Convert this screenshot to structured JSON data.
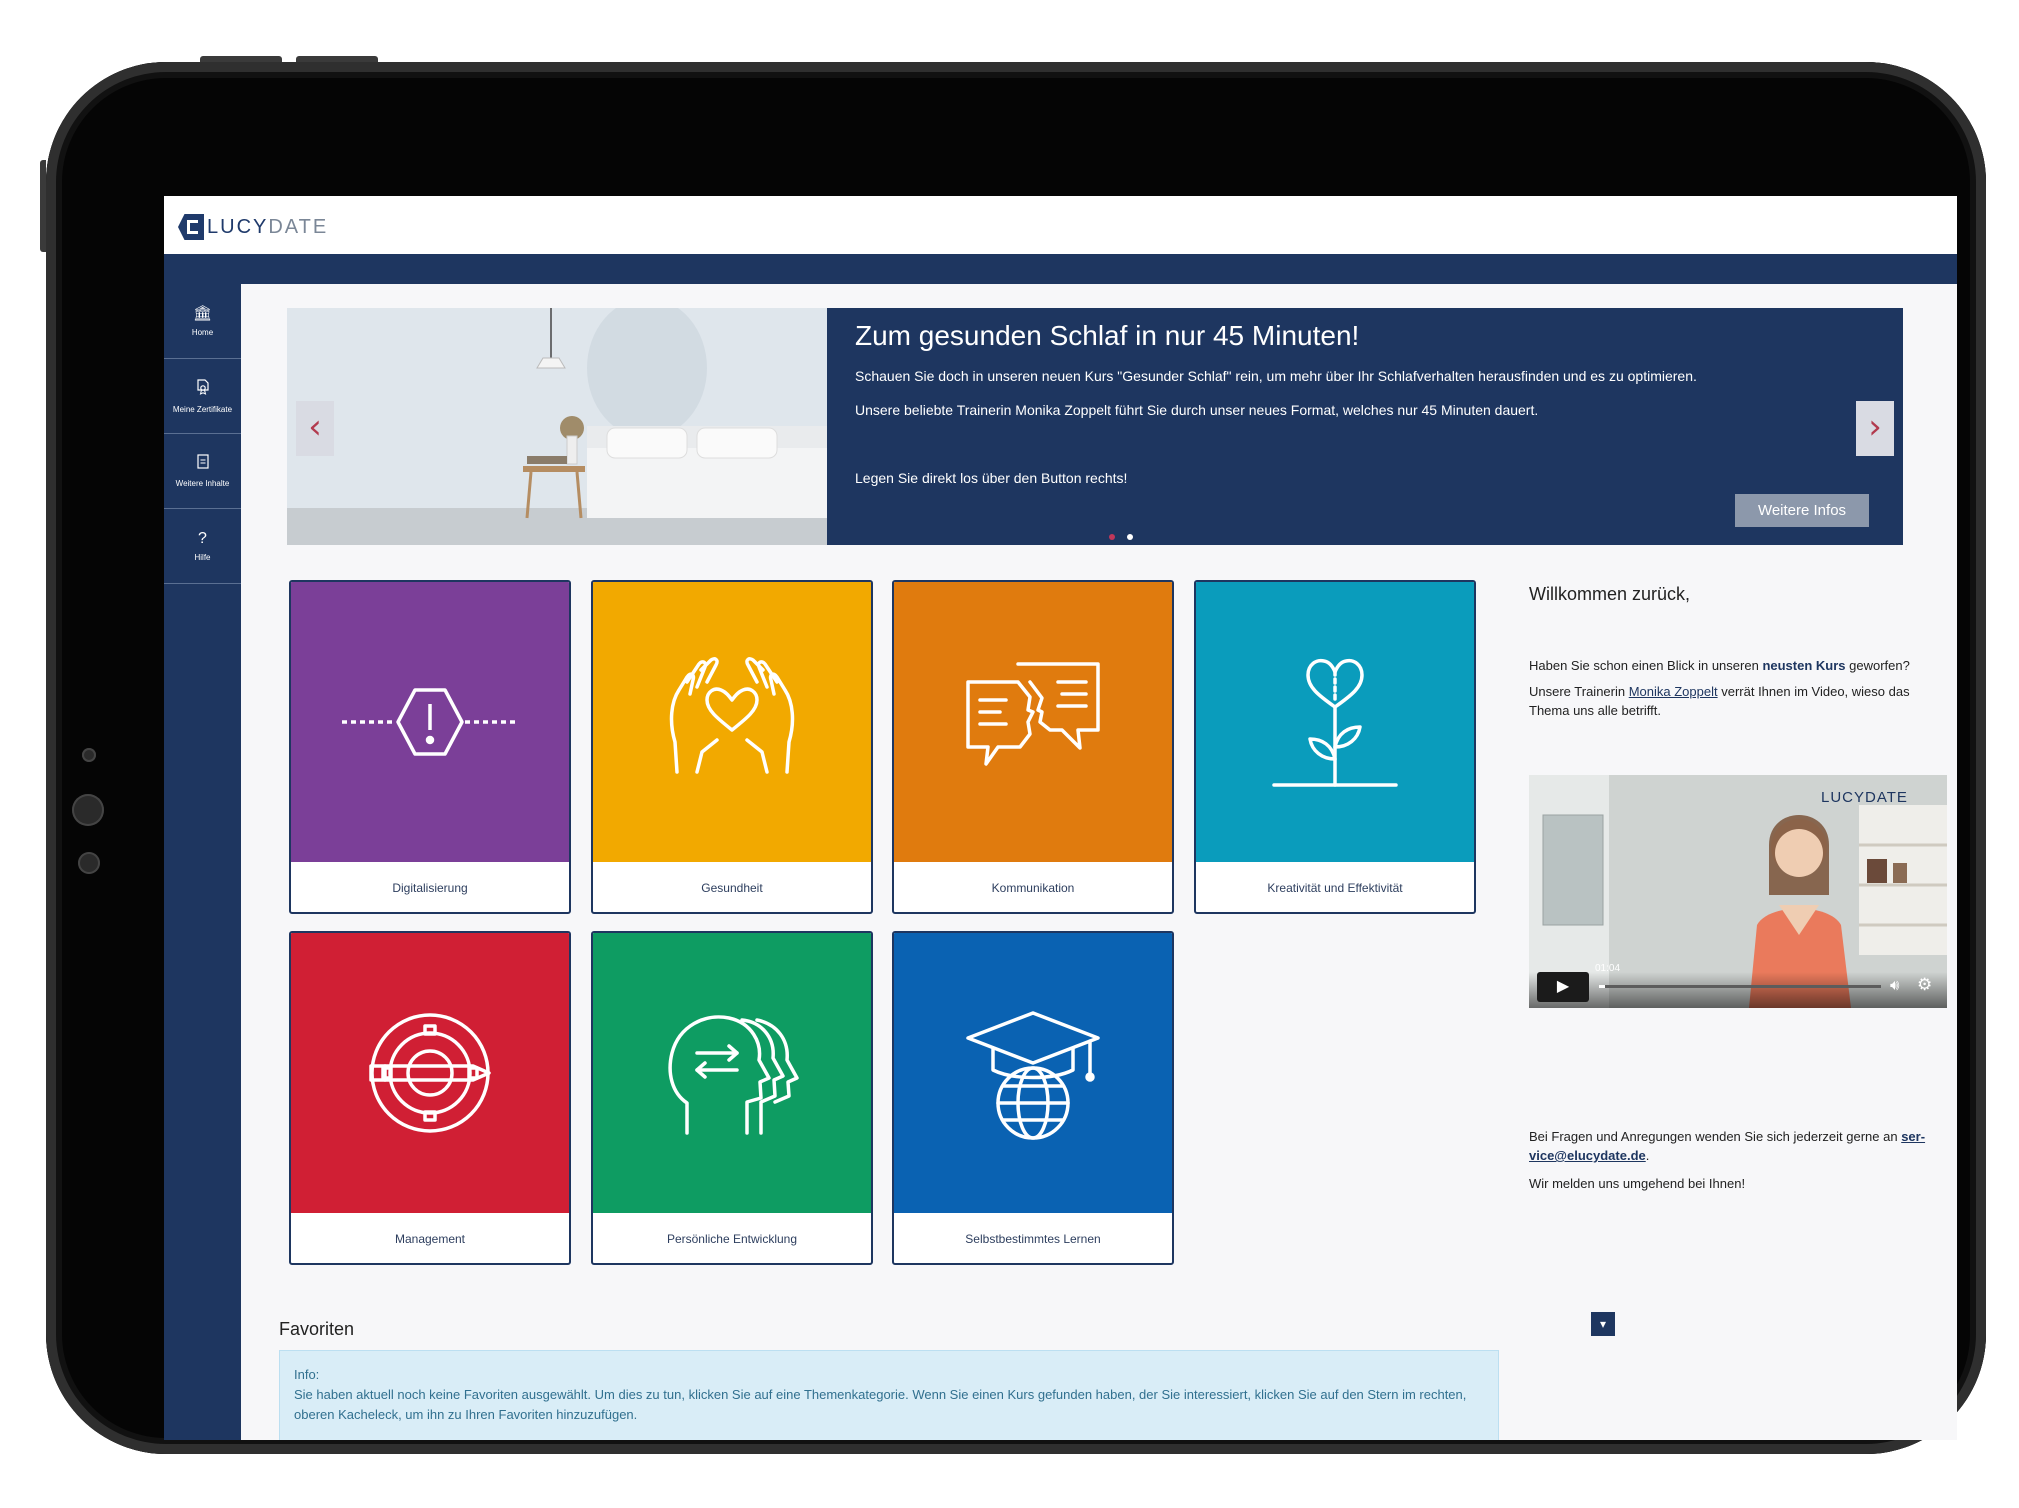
{
  "brand": {
    "logo_main": "LUCY",
    "logo_sub": "DATE"
  },
  "sidebar": {
    "items": [
      {
        "label": "Home",
        "icon": "bank-icon"
      },
      {
        "label": "Meine Zertifikate",
        "icon": "certificate-icon"
      },
      {
        "label": "Weitere Inhalte",
        "icon": "document-icon"
      },
      {
        "label": "Hilfe",
        "icon": "question-icon"
      }
    ]
  },
  "hero": {
    "title": "Zum gesunden Schlaf in nur 45 Minuten!",
    "line1": "Schauen Sie doch in unseren neuen Kurs \"Gesunder Schlaf\" rein, um mehr über Ihr Schlafverhalten herausfinden und es zu optimieren.",
    "line2": "Unsere beliebte Trainerin Monika Zoppelt führt Sie durch unser neues Format, welches nur 45 Minuten dauert.",
    "line3": "Legen Sie direkt los über den Button rechts!",
    "button": "Weitere Infos",
    "prev_arrow": "‹",
    "next_arrow": "›",
    "slide_count": 2,
    "active_slide": 1,
    "colors": {
      "background": "#1e3660",
      "active_dot": "#c0375a",
      "inactive_dot": "#ffffff"
    }
  },
  "categories": [
    {
      "label": "Digitalisierung",
      "color": "#7b3f98",
      "icon": "hexagon-alert-icon"
    },
    {
      "label": "Gesundheit",
      "color": "#f2a900",
      "icon": "hands-heart-icon"
    },
    {
      "label": "Kommunikation",
      "color": "#e07b0e",
      "icon": "speech-faces-icon"
    },
    {
      "label": "Kreativität und Effektivität",
      "color": "#0a9cbc",
      "icon": "heart-plant-icon"
    },
    {
      "label": "Management",
      "color": "#d01f34",
      "icon": "gear-pencil-icon"
    },
    {
      "label": "Persönliche Entwicklung",
      "color": "#0e9c62",
      "icon": "heads-arrows-icon"
    },
    {
      "label": "Selbstbestimmtes Lernen",
      "color": "#0a62b2",
      "icon": "graduation-globe-icon"
    }
  ],
  "welcome": {
    "greeting": "Willkommen zurück,",
    "p1_before": "Haben Sie schon einen Blick in unseren ",
    "p1_bold": "neusten Kurs",
    "p1_after": " geworfen?",
    "p2_before": "Unsere Trainerin ",
    "p2_link": "Monika Zoppelt",
    "p2_after": " verrät Ihnen im Video, wieso das Thema uns alle betrifft.",
    "contact_before": "Bei Fragen und Anregungen wenden Sie sich jederzeit gerne an ",
    "contact_link_1": "ser-",
    "contact_link_2": "vice@elucydate.de",
    "contact_after": ".",
    "contact_line2": "Wir melden uns umgehend bei Ihnen!"
  },
  "video": {
    "time": "01:04",
    "watermark": "LUCYDATE",
    "progress": 0.02
  },
  "favorites": {
    "title": "Favoriten",
    "info_title": "Info:",
    "info_text": "Sie haben aktuell noch keine Favoriten ausgewählt. Um dies zu tun, klicken Sie auf eine Themenkategorie. Wenn Sie einen Kurs gefunden haben, der Sie interessiert, klicken Sie auf den Stern im rechten, oberen Kacheleck, um ihn zu Ihren Favoriten hinzuzufügen."
  }
}
